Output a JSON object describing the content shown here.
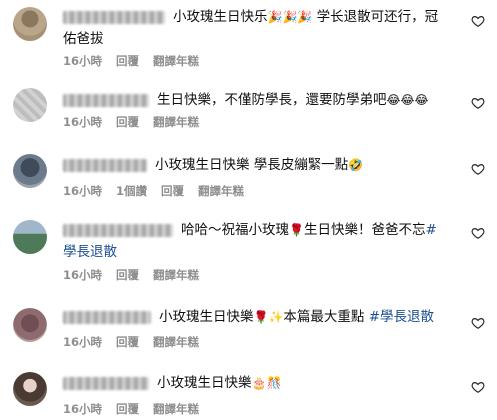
{
  "comments": [
    {
      "username": "sharrynewsman",
      "text": "小玫瑰生日快乐",
      "emoji": "🎉🎉🎉",
      "text2": " 学长退散可还行，冠佑爸拔",
      "hashtag": "",
      "time": "16小時",
      "replies": "",
      "reply": "回覆",
      "translate": "翻譯年糕",
      "avatar_color": "#b8a58a"
    },
    {
      "username": "yichen0531",
      "text": "生日快樂，不僅防學長，還要防學弟吧",
      "emoji": "😂😂😂",
      "text2": "",
      "hashtag": "",
      "time": "16小時",
      "replies": "",
      "reply": "回覆",
      "translate": "翻譯年糕",
      "avatar_color": "#c9c9c9"
    },
    {
      "username": "das_chi0410",
      "text": "小玫瑰生日快樂 學長皮繃緊一點",
      "emoji": "🤣",
      "text2": "",
      "hashtag": "",
      "time": "16小時",
      "replies": "1個讚",
      "reply": "回覆",
      "translate": "翻譯年糕",
      "avatar_color": "#5b6a7a"
    },
    {
      "username": "mimi_huang627",
      "text": "哈哈～祝福小玫瑰",
      "emoji": "🌹",
      "text2": "生日快樂！爸爸不忘",
      "hashtag": "#學長退散",
      "time": "16小時",
      "replies": "",
      "reply": "回覆",
      "translate": "翻譯年糕",
      "avatar_color": "#4f7a59"
    },
    {
      "username": "lincotus0325",
      "text": "小玫瑰生日快樂",
      "emoji": "🌹✨",
      "text2": "本篇最大重點 ",
      "hashtag": "#學長退散",
      "time": "16小時",
      "replies": "",
      "reply": "回覆",
      "translate": "翻譯年糕",
      "avatar_color": "#8d6b6e"
    },
    {
      "username": "sdar760084",
      "text": "小玫瑰生日快樂",
      "emoji": "🎂🎊",
      "text2": "",
      "hashtag": "",
      "time": "16小時",
      "replies": "",
      "reply": "回覆",
      "translate": "翻譯年糕",
      "avatar_color": "#6b5a52"
    }
  ],
  "icons": {
    "like": "heart-outline-icon"
  }
}
